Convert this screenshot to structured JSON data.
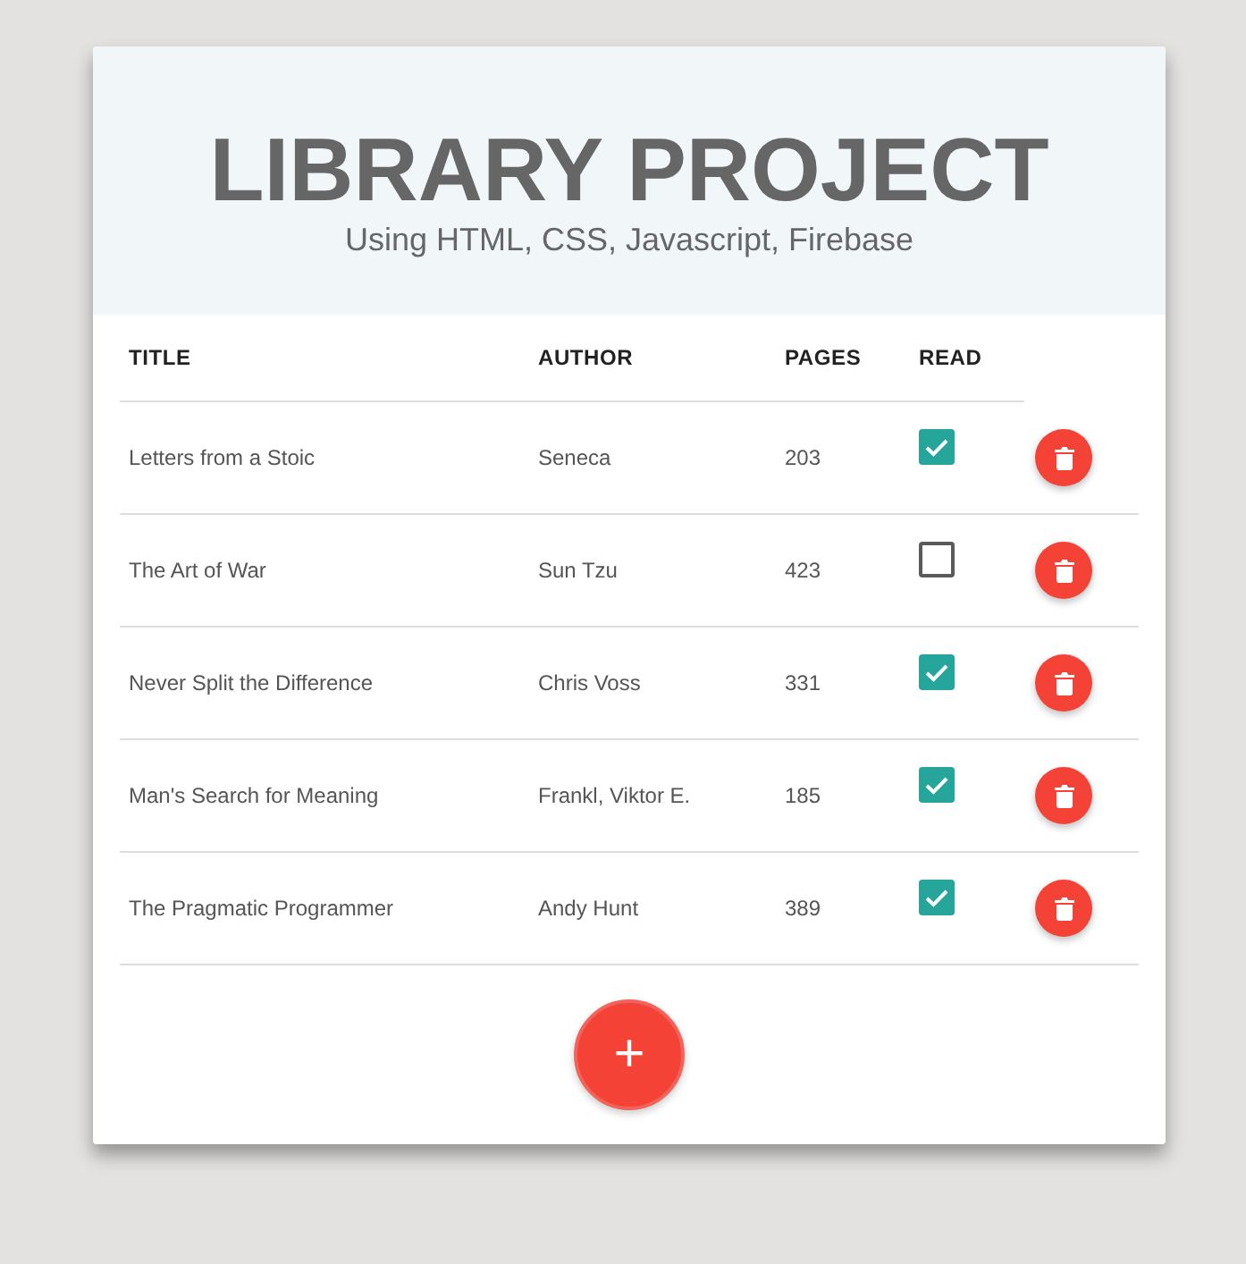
{
  "header": {
    "title": "LIBRARY PROJECT",
    "subtitle": "Using HTML, CSS, Javascript, Firebase"
  },
  "table": {
    "columns": [
      "TITLE",
      "AUTHOR",
      "PAGES",
      "READ"
    ],
    "rows": [
      {
        "title": "Letters from a Stoic",
        "author": "Seneca",
        "pages": "203",
        "read": true
      },
      {
        "title": "The Art of War",
        "author": "Sun Tzu",
        "pages": "423",
        "read": false
      },
      {
        "title": "Never Split the Difference",
        "author": "Chris Voss",
        "pages": "331",
        "read": true
      },
      {
        "title": "Man's Search for Meaning",
        "author": "Frankl, Viktor E.",
        "pages": "185",
        "read": true
      },
      {
        "title": "The Pragmatic Programmer",
        "author": "Andy Hunt",
        "pages": "389",
        "read": true
      }
    ]
  },
  "add_button": {
    "label": "+"
  }
}
